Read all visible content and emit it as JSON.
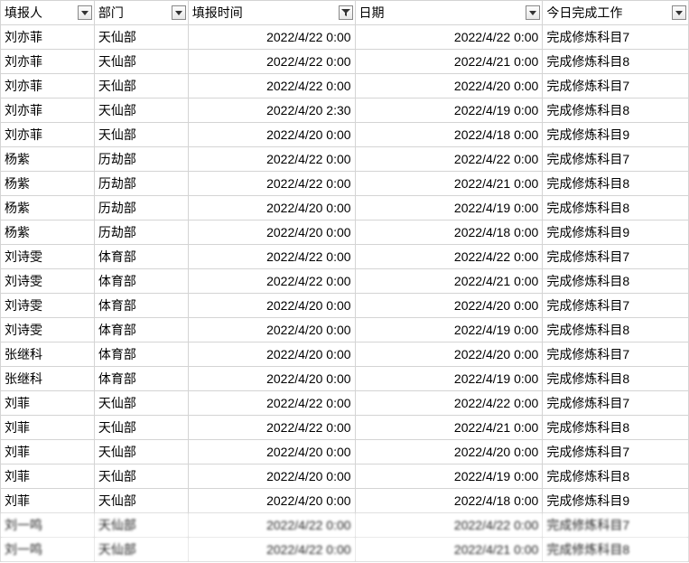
{
  "headers": [
    {
      "label": "填报人",
      "filtered": false
    },
    {
      "label": "部门",
      "filtered": false
    },
    {
      "label": "填报时间",
      "filtered": true
    },
    {
      "label": "日期",
      "filtered": false
    },
    {
      "label": "今日完成工作",
      "filtered": false
    }
  ],
  "rows": [
    {
      "c0": "刘亦菲",
      "c1": "天仙部",
      "c2": "2022/4/22 0:00",
      "c3": "2022/4/22 0:00",
      "c4": "完成修炼科目7"
    },
    {
      "c0": "刘亦菲",
      "c1": "天仙部",
      "c2": "2022/4/22 0:00",
      "c3": "2022/4/21 0:00",
      "c4": "完成修炼科目8"
    },
    {
      "c0": "刘亦菲",
      "c1": "天仙部",
      "c2": "2022/4/22 0:00",
      "c3": "2022/4/20 0:00",
      "c4": "完成修炼科目7"
    },
    {
      "c0": "刘亦菲",
      "c1": "天仙部",
      "c2": "2022/4/20 2:30",
      "c3": "2022/4/19 0:00",
      "c4": "完成修炼科目8"
    },
    {
      "c0": "刘亦菲",
      "c1": "天仙部",
      "c2": "2022/4/20 0:00",
      "c3": "2022/4/18 0:00",
      "c4": "完成修炼科目9"
    },
    {
      "c0": "杨紫",
      "c1": "历劫部",
      "c2": "2022/4/22 0:00",
      "c3": "2022/4/22 0:00",
      "c4": "完成修炼科目7"
    },
    {
      "c0": "杨紫",
      "c1": "历劫部",
      "c2": "2022/4/22 0:00",
      "c3": "2022/4/21 0:00",
      "c4": "完成修炼科目8"
    },
    {
      "c0": "杨紫",
      "c1": "历劫部",
      "c2": "2022/4/20 0:00",
      "c3": "2022/4/19 0:00",
      "c4": "完成修炼科目8"
    },
    {
      "c0": "杨紫",
      "c1": "历劫部",
      "c2": "2022/4/20 0:00",
      "c3": "2022/4/18 0:00",
      "c4": "完成修炼科目9"
    },
    {
      "c0": "刘诗雯",
      "c1": "体育部",
      "c2": "2022/4/22 0:00",
      "c3": "2022/4/22 0:00",
      "c4": "完成修炼科目7"
    },
    {
      "c0": "刘诗雯",
      "c1": "体育部",
      "c2": "2022/4/22 0:00",
      "c3": "2022/4/21 0:00",
      "c4": "完成修炼科目8"
    },
    {
      "c0": "刘诗雯",
      "c1": "体育部",
      "c2": "2022/4/20 0:00",
      "c3": "2022/4/20 0:00",
      "c4": "完成修炼科目7"
    },
    {
      "c0": "刘诗雯",
      "c1": "体育部",
      "c2": "2022/4/20 0:00",
      "c3": "2022/4/19 0:00",
      "c4": "完成修炼科目8"
    },
    {
      "c0": "张继科",
      "c1": "体育部",
      "c2": "2022/4/20 0:00",
      "c3": "2022/4/20 0:00",
      "c4": "完成修炼科目7"
    },
    {
      "c0": "张继科",
      "c1": "体育部",
      "c2": "2022/4/20 0:00",
      "c3": "2022/4/19 0:00",
      "c4": "完成修炼科目8"
    },
    {
      "c0": "刘菲",
      "c1": "天仙部",
      "c2": "2022/4/22 0:00",
      "c3": "2022/4/22 0:00",
      "c4": "完成修炼科目7"
    },
    {
      "c0": "刘菲",
      "c1": "天仙部",
      "c2": "2022/4/22 0:00",
      "c3": "2022/4/21 0:00",
      "c4": "完成修炼科目8"
    },
    {
      "c0": "刘菲",
      "c1": "天仙部",
      "c2": "2022/4/20 0:00",
      "c3": "2022/4/20 0:00",
      "c4": "完成修炼科目7"
    },
    {
      "c0": "刘菲",
      "c1": "天仙部",
      "c2": "2022/4/20 0:00",
      "c3": "2022/4/19 0:00",
      "c4": "完成修炼科目8"
    },
    {
      "c0": "刘菲",
      "c1": "天仙部",
      "c2": "2022/4/20 0:00",
      "c3": "2022/4/18 0:00",
      "c4": "完成修炼科目9"
    },
    {
      "c0": "刘一鸣",
      "c1": "天仙部",
      "c2": "2022/4/22 0:00",
      "c3": "2022/4/22 0:00",
      "c4": "完成修炼科目7",
      "blur": true
    },
    {
      "c0": "刘一鸣",
      "c1": "天仙部",
      "c2": "2022/4/22 0:00",
      "c3": "2022/4/21 0:00",
      "c4": "完成修炼科目8",
      "blur": true
    }
  ]
}
